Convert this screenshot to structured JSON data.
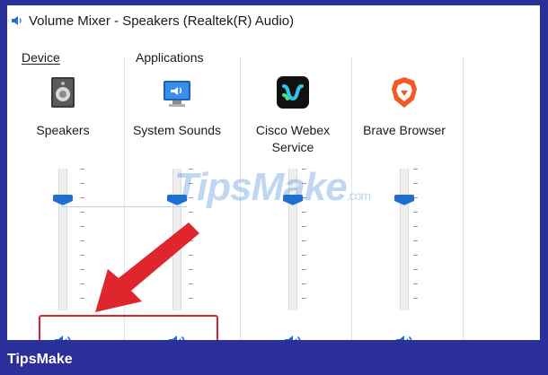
{
  "window": {
    "title": "Volume Mixer - Speakers (Realtek(R) Audio)"
  },
  "sections": {
    "device_label": "Device",
    "applications_label": "Applications"
  },
  "channels": [
    {
      "name": "Speakers",
      "icon": "speaker-device-icon",
      "level": 0.78
    },
    {
      "name": "System Sounds",
      "icon": "system-sounds-icon",
      "level": 0.78
    },
    {
      "name": "Cisco Webex Service",
      "name_line1": "Cisco Webex",
      "name_line2": "Service",
      "icon": "webex-app-icon",
      "level": 0.78
    },
    {
      "name": "Brave Browser",
      "icon": "brave-browser-icon",
      "level": 0.78
    }
  ],
  "watermark": {
    "text": "TipsMake",
    "suffix": ".com"
  },
  "footer": {
    "brand": "TipsMake"
  },
  "colors": {
    "accent": "#1e6fd1",
    "frame": "#2b2f9a",
    "highlight": "#d9232e"
  }
}
